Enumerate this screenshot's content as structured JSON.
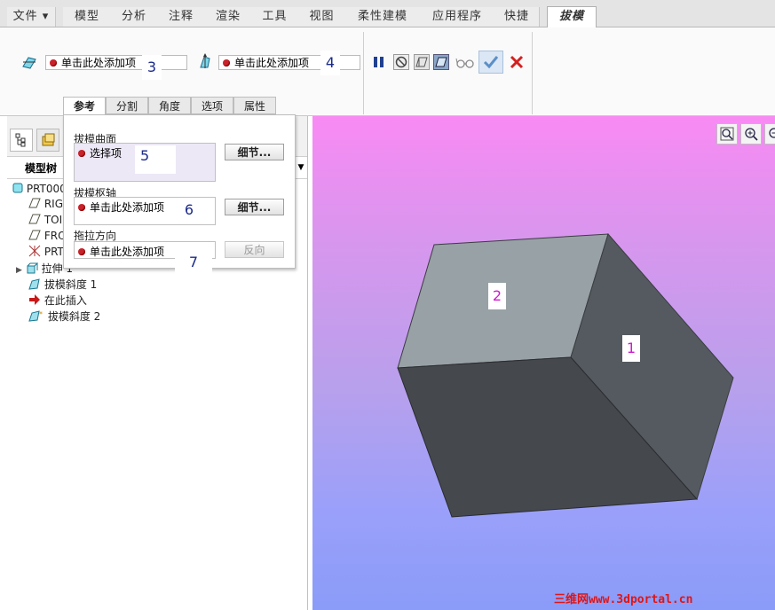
{
  "tabs": [
    {
      "label": "文件 ▾"
    },
    {
      "label": "模型"
    },
    {
      "label": "分析"
    },
    {
      "label": "注释"
    },
    {
      "label": "渲染"
    },
    {
      "label": "工具"
    },
    {
      "label": "视图"
    },
    {
      "label": "柔性建模"
    },
    {
      "label": "应用程序"
    },
    {
      "label": "快捷"
    },
    {
      "label": "拔模"
    }
  ],
  "ribbon": {
    "collector1": "单击此处添加项",
    "collector1_num": "3",
    "collector2": "单击此处添加项",
    "collector2_num": "4"
  },
  "subtabs": [
    {
      "label": "参考"
    },
    {
      "label": "分割"
    },
    {
      "label": "角度"
    },
    {
      "label": "选项"
    },
    {
      "label": "属性"
    }
  ],
  "panel": {
    "surfaces_label": "拔模曲面",
    "surfaces_value": "选择项",
    "surfaces_num": "5",
    "details1": "细节...",
    "hinge_label": "拔模枢轴",
    "hinge_value": "单击此处添加项",
    "hinge_num": "6",
    "details2": "细节...",
    "pull_label": "拖拉方向",
    "pull_value": "单击此处添加项",
    "pull_num": "7",
    "flip": "反向"
  },
  "tree": {
    "header": "模型树",
    "items": [
      {
        "label": "PRT000"
      },
      {
        "label": "RIG"
      },
      {
        "label": "TOI"
      },
      {
        "label": "FRO"
      },
      {
        "label": "PRT"
      },
      {
        "label": "拉伸 1"
      },
      {
        "label": "拔模斜度 1"
      },
      {
        "label": "在此插入"
      },
      {
        "label": "拔模斜度 2"
      }
    ]
  },
  "viewport": {
    "face1": "1",
    "face2": "2",
    "watermark": "三维网www.3dportal.cn"
  },
  "colors": {
    "accent_red": "#c8232a",
    "check_blue": "#5b8fc8",
    "cancel_red": "#d42020"
  }
}
